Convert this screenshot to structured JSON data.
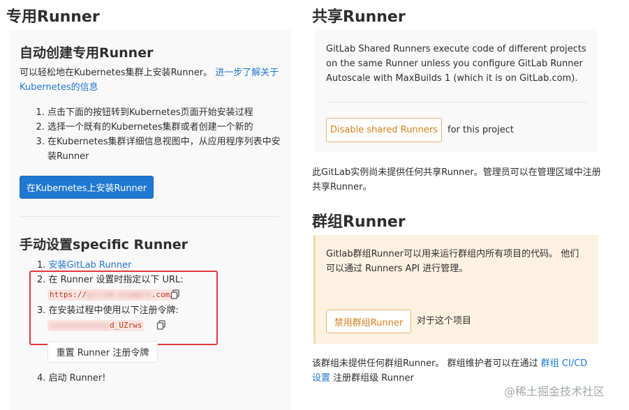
{
  "specific": {
    "title": "专用Runner",
    "auto": {
      "title": "自动创建专用Runner",
      "intro": "可以轻松地在Kubernetes集群上安装Runner。",
      "learn_more_link": "进一步了解关于Kubernetes的信息",
      "steps": [
        "点击下面的按钮转到Kubernetes页面开始安装过程",
        "选择一个既有的Kubernetes集群或者创建一个新的",
        "在Kubernetes集群详细信息视图中，从应用程序列表中安装Runner"
      ],
      "install_button": "在Kubernetes上安装Runner"
    },
    "manual": {
      "title": "手动设置specific Runner",
      "step1_link": "安装GitLab Runner",
      "step2_label": "在 Runner 设置时指定以下 URL:",
      "url_value": "https://gitlab.example.com/",
      "url_hidden": "gitlab.example",
      "url_prefix": "https://",
      "url_suffix": ".com/",
      "step3_label": "在安装过程中使用以下注册令牌:",
      "token_hidden": "xxxxxxxxxxxxx",
      "token_suffix": "d_UZrws",
      "reset_button": "重置 Runner 注册令牌",
      "step4_label": "启动 Runner!"
    }
  },
  "shared": {
    "title": "共享Runner",
    "description": "GitLab Shared Runners execute code of different projects on the same Runner unless you configure GitLab Runner Autoscale with MaxBuilds 1 (which it is on GitLab.com).",
    "disable_button": "Disable shared Runners",
    "for_project": "for this project",
    "none_text": "此GitLab实例尚未提供任何共享Runner。管理员可以在管理区域中注册共享Runner。"
  },
  "group": {
    "title": "群组Runner",
    "description": "Gitlab群组Runner可以用来运行群组内所有项目的代码。 他们可以通过 Runners API 进行管理。",
    "disable_button": "禁用群组Runner",
    "for_project": "对于这个项目",
    "none_text_prefix": "该群组未提供任何群组Runner。 群组维护者可以在通过",
    "none_text_link": "群组 CI/CD 设置",
    "none_text_suffix": "注册群组级 Runner"
  },
  "watermark": "@稀土掘金技术社区",
  "colors": {
    "link": "#1f78d1",
    "primary_button": "#1f78d1",
    "warning_button_text": "#d7801a",
    "warning_panel": "#fdf2e1",
    "highlight_box": "#e0393e"
  }
}
